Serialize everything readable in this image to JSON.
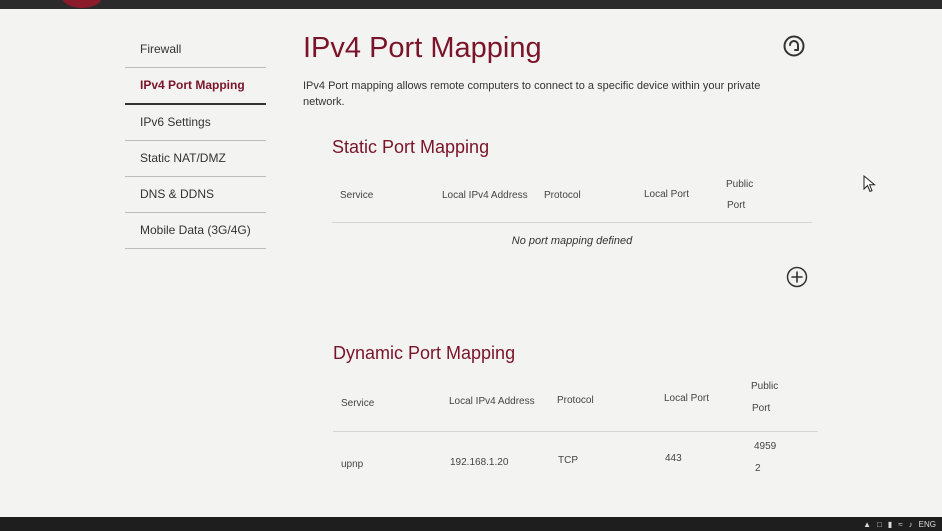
{
  "sidebar": {
    "items": [
      {
        "label": "Firewall"
      },
      {
        "label": "IPv4 Port Mapping"
      },
      {
        "label": "IPv6 Settings"
      },
      {
        "label": "Static NAT/DMZ"
      },
      {
        "label": "DNS & DDNS"
      },
      {
        "label": "Mobile Data (3G/4G)"
      }
    ],
    "active_index": 1
  },
  "page": {
    "title": "IPv4 Port Mapping",
    "description": "IPv4 Port mapping allows remote computers to connect to a specific device within your private network.",
    "help_icon": "help-circle-icon"
  },
  "static_mapping": {
    "title": "Static Port Mapping",
    "columns": [
      "Service",
      "Local IPv4 Address",
      "Protocol",
      "Local Port",
      "Public",
      "Port"
    ],
    "empty_message": "No port mapping defined",
    "add_icon": "plus-circle-icon"
  },
  "dynamic_mapping": {
    "title": "Dynamic Port Mapping",
    "columns": [
      "Service",
      "Local IPv4 Address",
      "Protocol",
      "Local Port",
      "Public",
      "Port"
    ],
    "rows": [
      {
        "service": "upnp",
        "local_address": "192.168.1.20",
        "protocol": "TCP",
        "local_port": "443",
        "public_port_line1": "4959",
        "public_port_line2": "2"
      }
    ]
  },
  "taskbar": {
    "language": "ENG",
    "icons": [
      "chevron-up-icon",
      "notification-icon",
      "battery-icon",
      "wifi-icon",
      "volume-icon"
    ]
  },
  "colors": {
    "accent": "#7a1428",
    "background": "#f3f3f1",
    "text": "#333333"
  }
}
